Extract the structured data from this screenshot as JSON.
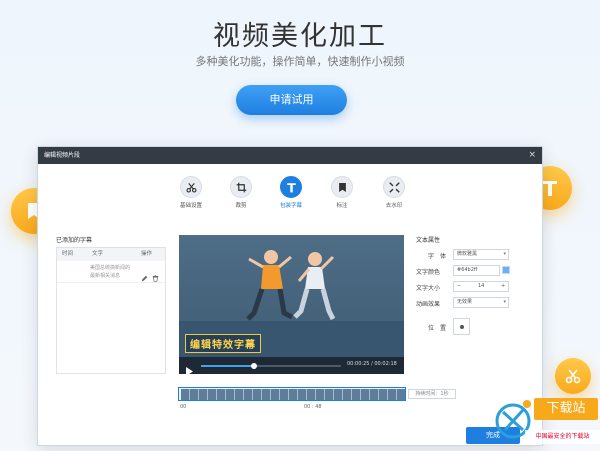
{
  "hero": {
    "title": "视频美化加工",
    "subtitle": "多种美化功能，操作简单，快速制作小视频",
    "cta_label": "申请试用"
  },
  "window": {
    "title": "编辑视频片段",
    "close_glyph": "×"
  },
  "toolbar": {
    "items": [
      {
        "label": "基础设置",
        "icon": "scissors-icon",
        "active": false
      },
      {
        "label": "裁剪",
        "icon": "crop-icon",
        "active": false
      },
      {
        "label": "包装字幕",
        "icon": "text-icon",
        "active": true
      },
      {
        "label": "标注",
        "icon": "bookmark-icon",
        "active": false
      },
      {
        "label": "去水印",
        "icon": "watermark-icon",
        "active": false
      }
    ]
  },
  "subtitles_panel": {
    "title": "已添加的字幕",
    "columns": [
      "时间",
      "文字",
      "操作"
    ],
    "rows": [
      {
        "time": "",
        "text": "美国总统搞新闻的最新相关消息"
      }
    ]
  },
  "player": {
    "caption": "编辑特效字幕",
    "time_current": "00:00:25",
    "time_total": "00:02:18",
    "time_separator": "/",
    "progress": 0.38
  },
  "text_props": {
    "title": "文本属性",
    "font_label": "字　体",
    "font_value": "微软雅黑",
    "color_label": "文字颜色",
    "color_value": "#64b2ff",
    "size_label": "文字大小",
    "size_minus": "−",
    "size_value": "14",
    "size_plus": "+",
    "anim_label": "动画效果",
    "anim_value": "无效果",
    "pos_label": "位　置"
  },
  "timeline": {
    "start_marker": "00",
    "mid_marker": "00 : 48",
    "duration_label": "持续时间：1秒"
  },
  "done_label": "完成",
  "watermark": {
    "brand": "下载站",
    "slogan": "中国最安全的下载站"
  },
  "colors": {
    "accent": "#1f7fe0",
    "badge": "#f9a91c",
    "caption": "#ffd54a",
    "text_color_swatch": "#64b2ff"
  }
}
